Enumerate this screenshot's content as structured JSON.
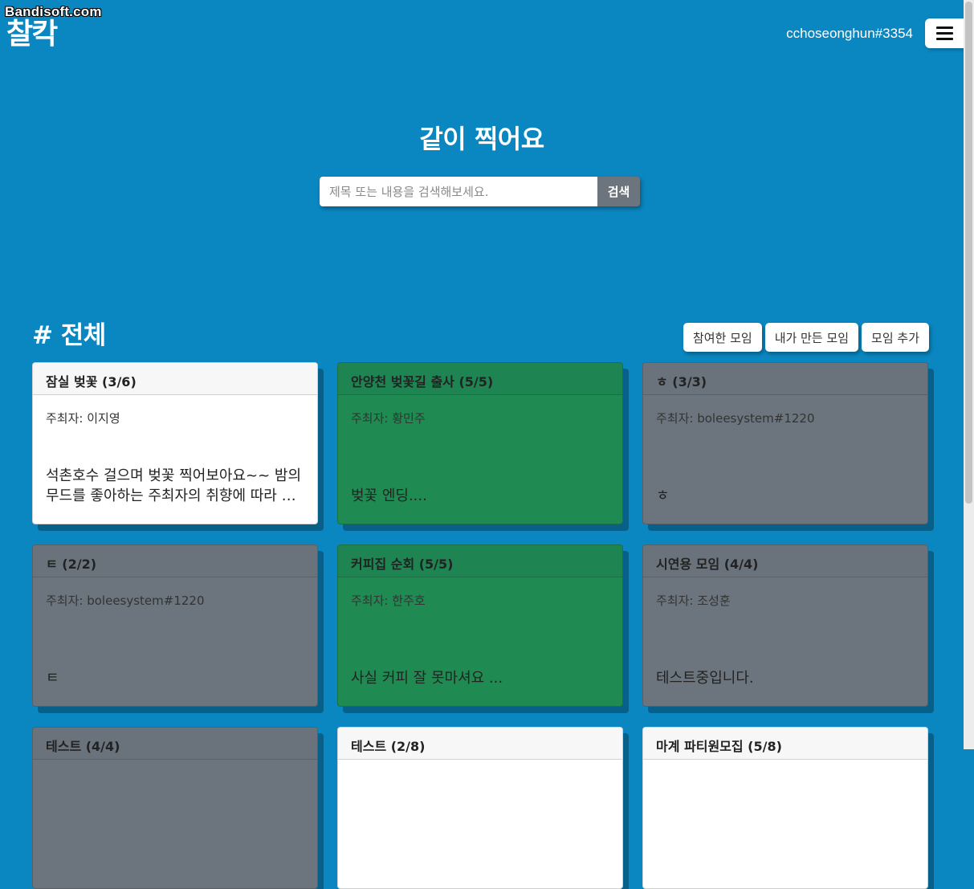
{
  "watermark": "Bandisoft.com",
  "header": {
    "logo": "찰칵",
    "username": "cchoseonghun#3354"
  },
  "hero": {
    "title": "같이 찍어요",
    "search_placeholder": "제목 또는 내용을 검색해보세요.",
    "search_button": "검색"
  },
  "section": {
    "title": "# 전체",
    "buttons": {
      "joined": "참여한 모임",
      "mine": "내가 만든 모임",
      "add": "모임 추가"
    }
  },
  "cards": [
    {
      "title": "잠실 벚꽃 (3/6)",
      "host": "주최자: 이지영",
      "desc": "석촌호수 걸으며 벚꽃 찍어보아요~~ 밤의 무드를 좋아하는 주최자의 취향에 따라 밤 시간대에 만나요",
      "style": "white"
    },
    {
      "title": "안양천 벚꽃길 출사 (5/5)",
      "host": "주최자: 황민주",
      "desc": "벚꽃 엔딩....",
      "style": "green"
    },
    {
      "title": "ㅎ (3/3)",
      "host": "주최자: boleesystem#1220",
      "desc": "ㅎ",
      "style": "gray"
    },
    {
      "title": "ㅌ (2/2)",
      "host": "주최자: boleesystem#1220",
      "desc": "ㅌ",
      "style": "gray"
    },
    {
      "title": "커피집 순회 (5/5)",
      "host": "주최자: 한주호",
      "desc": "사실 커피 잘 못마셔요 ...",
      "style": "green"
    },
    {
      "title": "시연용 모임 (4/4)",
      "host": "주최자: 조성훈",
      "desc": "테스트중입니다.",
      "style": "gray"
    },
    {
      "title": "테스트 (4/4)",
      "host": "",
      "desc": "",
      "style": "gray"
    },
    {
      "title": "테스트 (2/8)",
      "host": "",
      "desc": "",
      "style": "white"
    },
    {
      "title": "마계 파티원모집 (5/8)",
      "host": "",
      "desc": "",
      "style": "white"
    }
  ]
}
